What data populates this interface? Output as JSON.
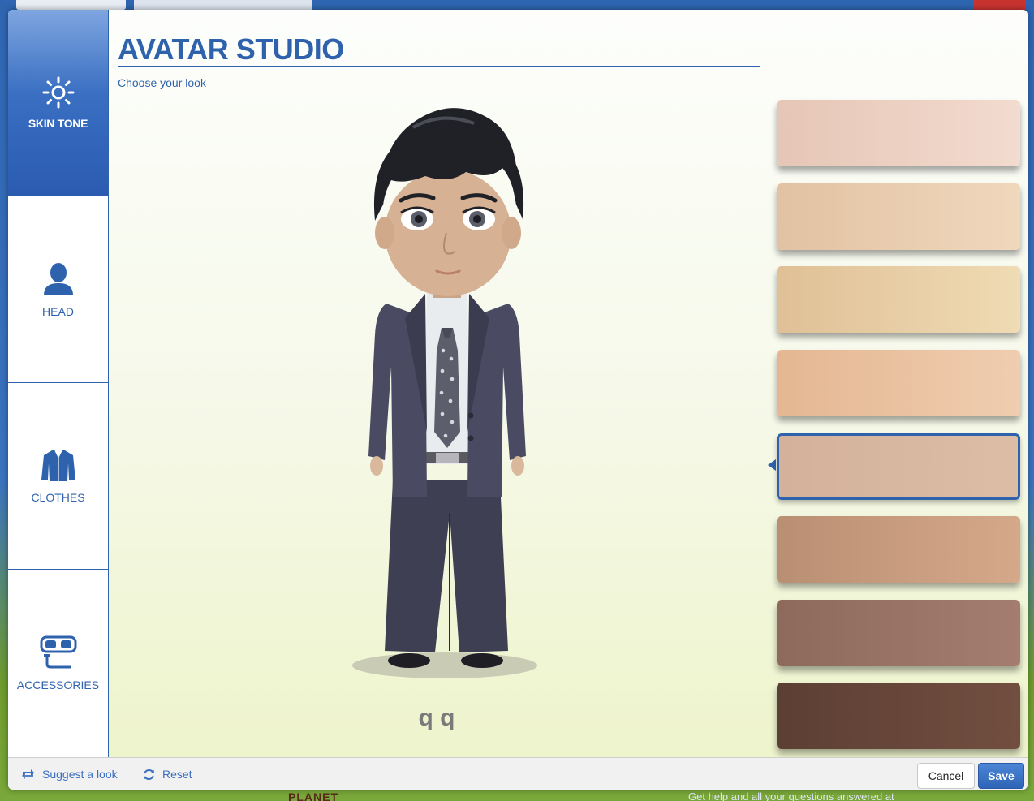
{
  "background": {
    "bottom_text": "Get help and all your questions answered at",
    "bottom_brand": "PLANET"
  },
  "sidebar": {
    "items": [
      {
        "label": "SKIN TONE",
        "icon": "sun-icon",
        "active": true
      },
      {
        "label": "HEAD",
        "icon": "person-head-icon",
        "active": false
      },
      {
        "label": "CLOTHES",
        "icon": "jacket-icon",
        "active": false
      },
      {
        "label": "ACCESSORIES",
        "icon": "goggles-snorkel-icon",
        "active": false
      }
    ]
  },
  "main": {
    "title": "AVATAR STUDIO",
    "subtitle": "Choose your look",
    "avatar_name": "q q"
  },
  "skin_tones": {
    "selected_index": 4,
    "swatches": [
      {
        "from": "#e6c6b6",
        "to": "#f2dbcf"
      },
      {
        "from": "#e2c2a2",
        "to": "#f0d8bd"
      },
      {
        "from": "#e0c096",
        "to": "#efdbb4"
      },
      {
        "from": "#e4b792",
        "to": "#f0cdb0"
      },
      {
        "from": "#d4b19a",
        "to": "#dcbda5"
      },
      {
        "from": "#b98f73",
        "to": "#d6a88a"
      },
      {
        "from": "#8d6a5c",
        "to": "#a47d70"
      },
      {
        "from": "#5c3f33",
        "to": "#724e40"
      }
    ]
  },
  "footer": {
    "suggest_label": "Suggest a look",
    "reset_label": "Reset",
    "cancel_label": "Cancel",
    "save_label": "Save"
  },
  "colors": {
    "accent": "#2f62ad",
    "save_button": "#3a6fc2"
  }
}
